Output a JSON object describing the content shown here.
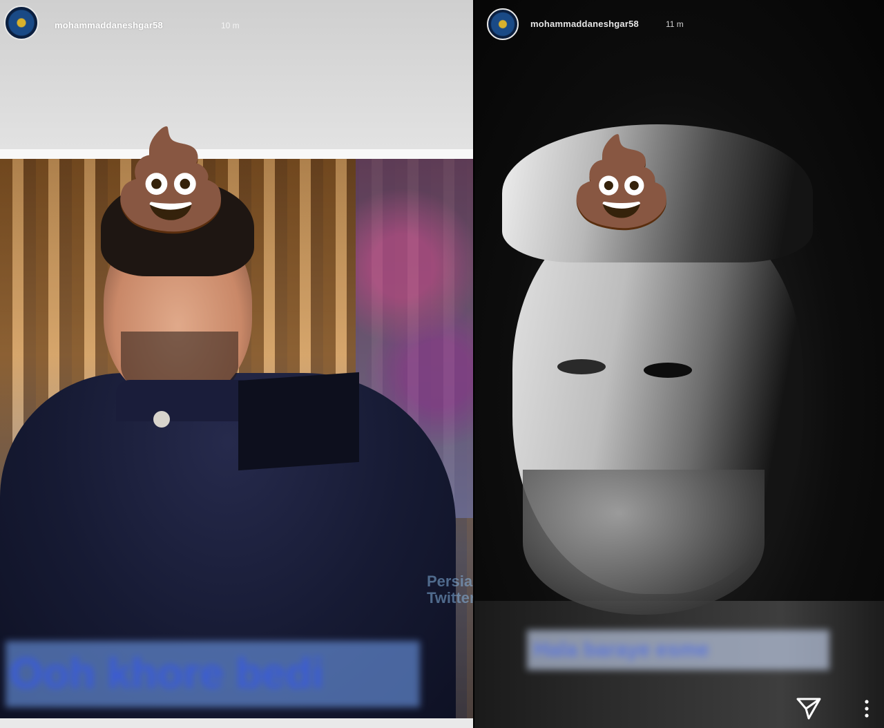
{
  "stories": [
    {
      "username": "mohammaddaneshgar58",
      "time": "10 m",
      "caption_blurred": "Ooh khore bedi",
      "watermark": "Persian Twitter"
    },
    {
      "username": "mohammaddaneshgar58",
      "time": "11 m",
      "caption_blurred": "Hala baraye esme"
    }
  ],
  "icons": {
    "poop": "💩",
    "send": "send-icon",
    "more": "more-vertical-icon"
  }
}
